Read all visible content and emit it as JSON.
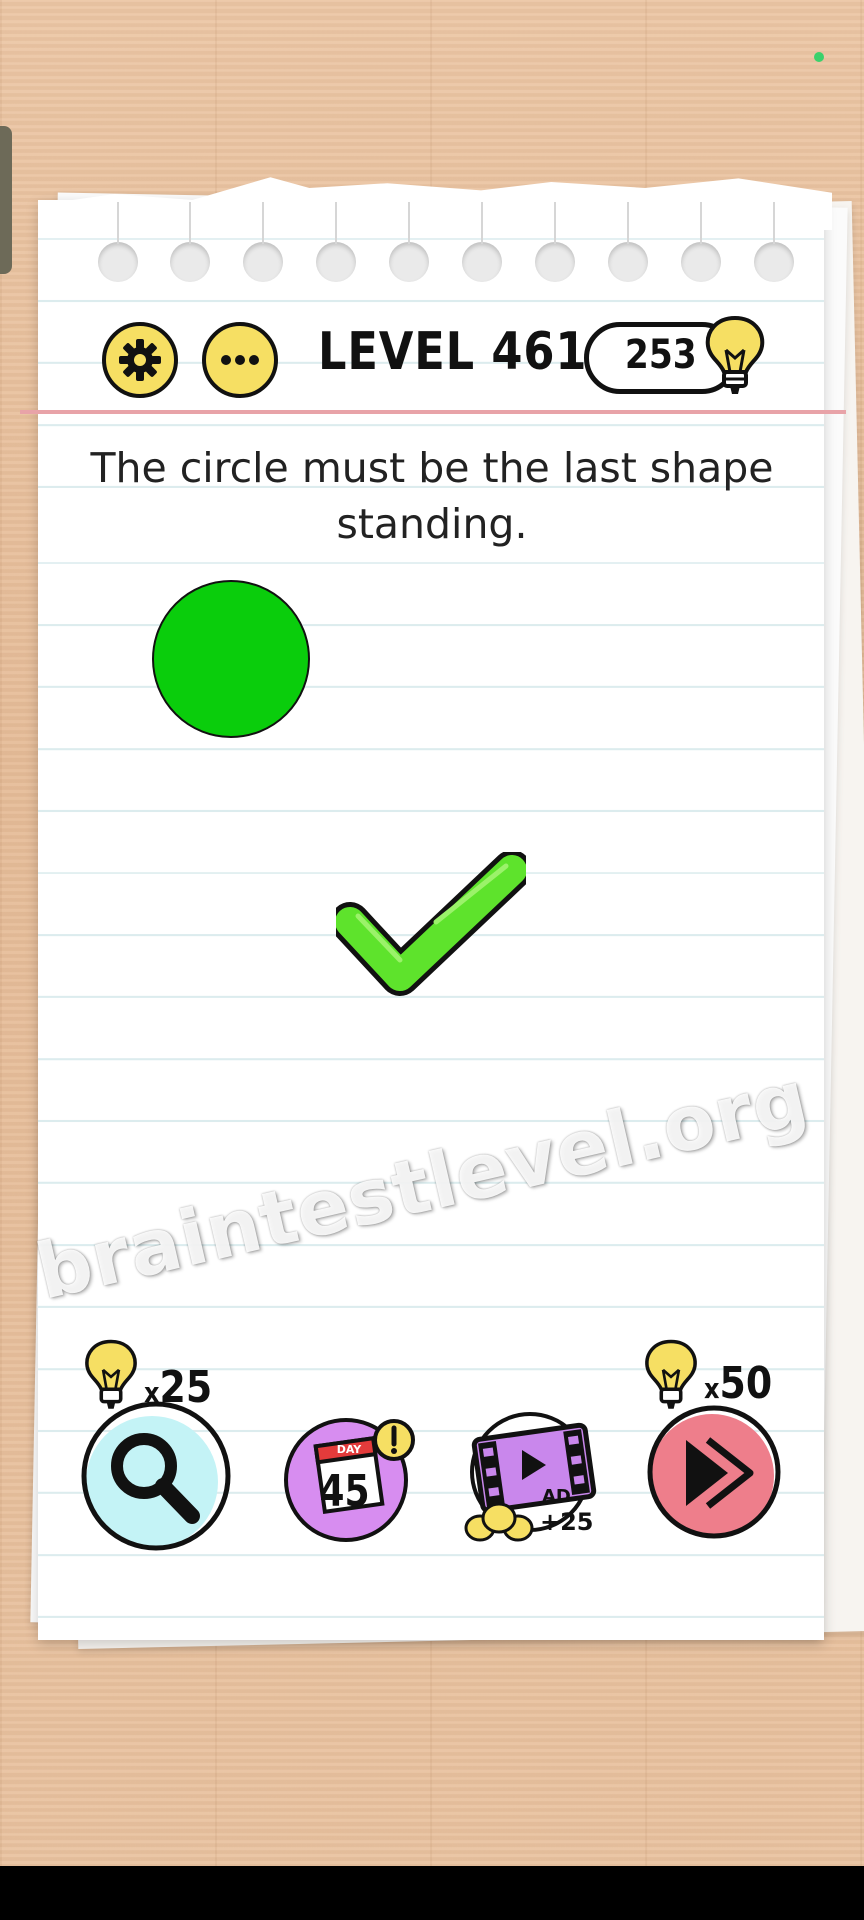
{
  "level": {
    "title": "LEVEL 461"
  },
  "hints": {
    "count": "253"
  },
  "puzzle": {
    "instruction": "The circle must be the last shape standing."
  },
  "tools": {
    "search_cost": "25",
    "skip_cost": "50",
    "daily_day_label": "DAY",
    "daily_day_number": "45",
    "ad_label": "AD",
    "ad_reward": "+25"
  },
  "watermark": "braintestlevel.org",
  "colors": {
    "circle": "#0acd0c",
    "checkmark": "#5ee32c",
    "button_yellow": "#f6df63",
    "search_bg": "#c4f3f6",
    "daily_bg": "#d78df0",
    "ad_bg": "#c987ec",
    "skip_bg": "#ee7e8b"
  }
}
